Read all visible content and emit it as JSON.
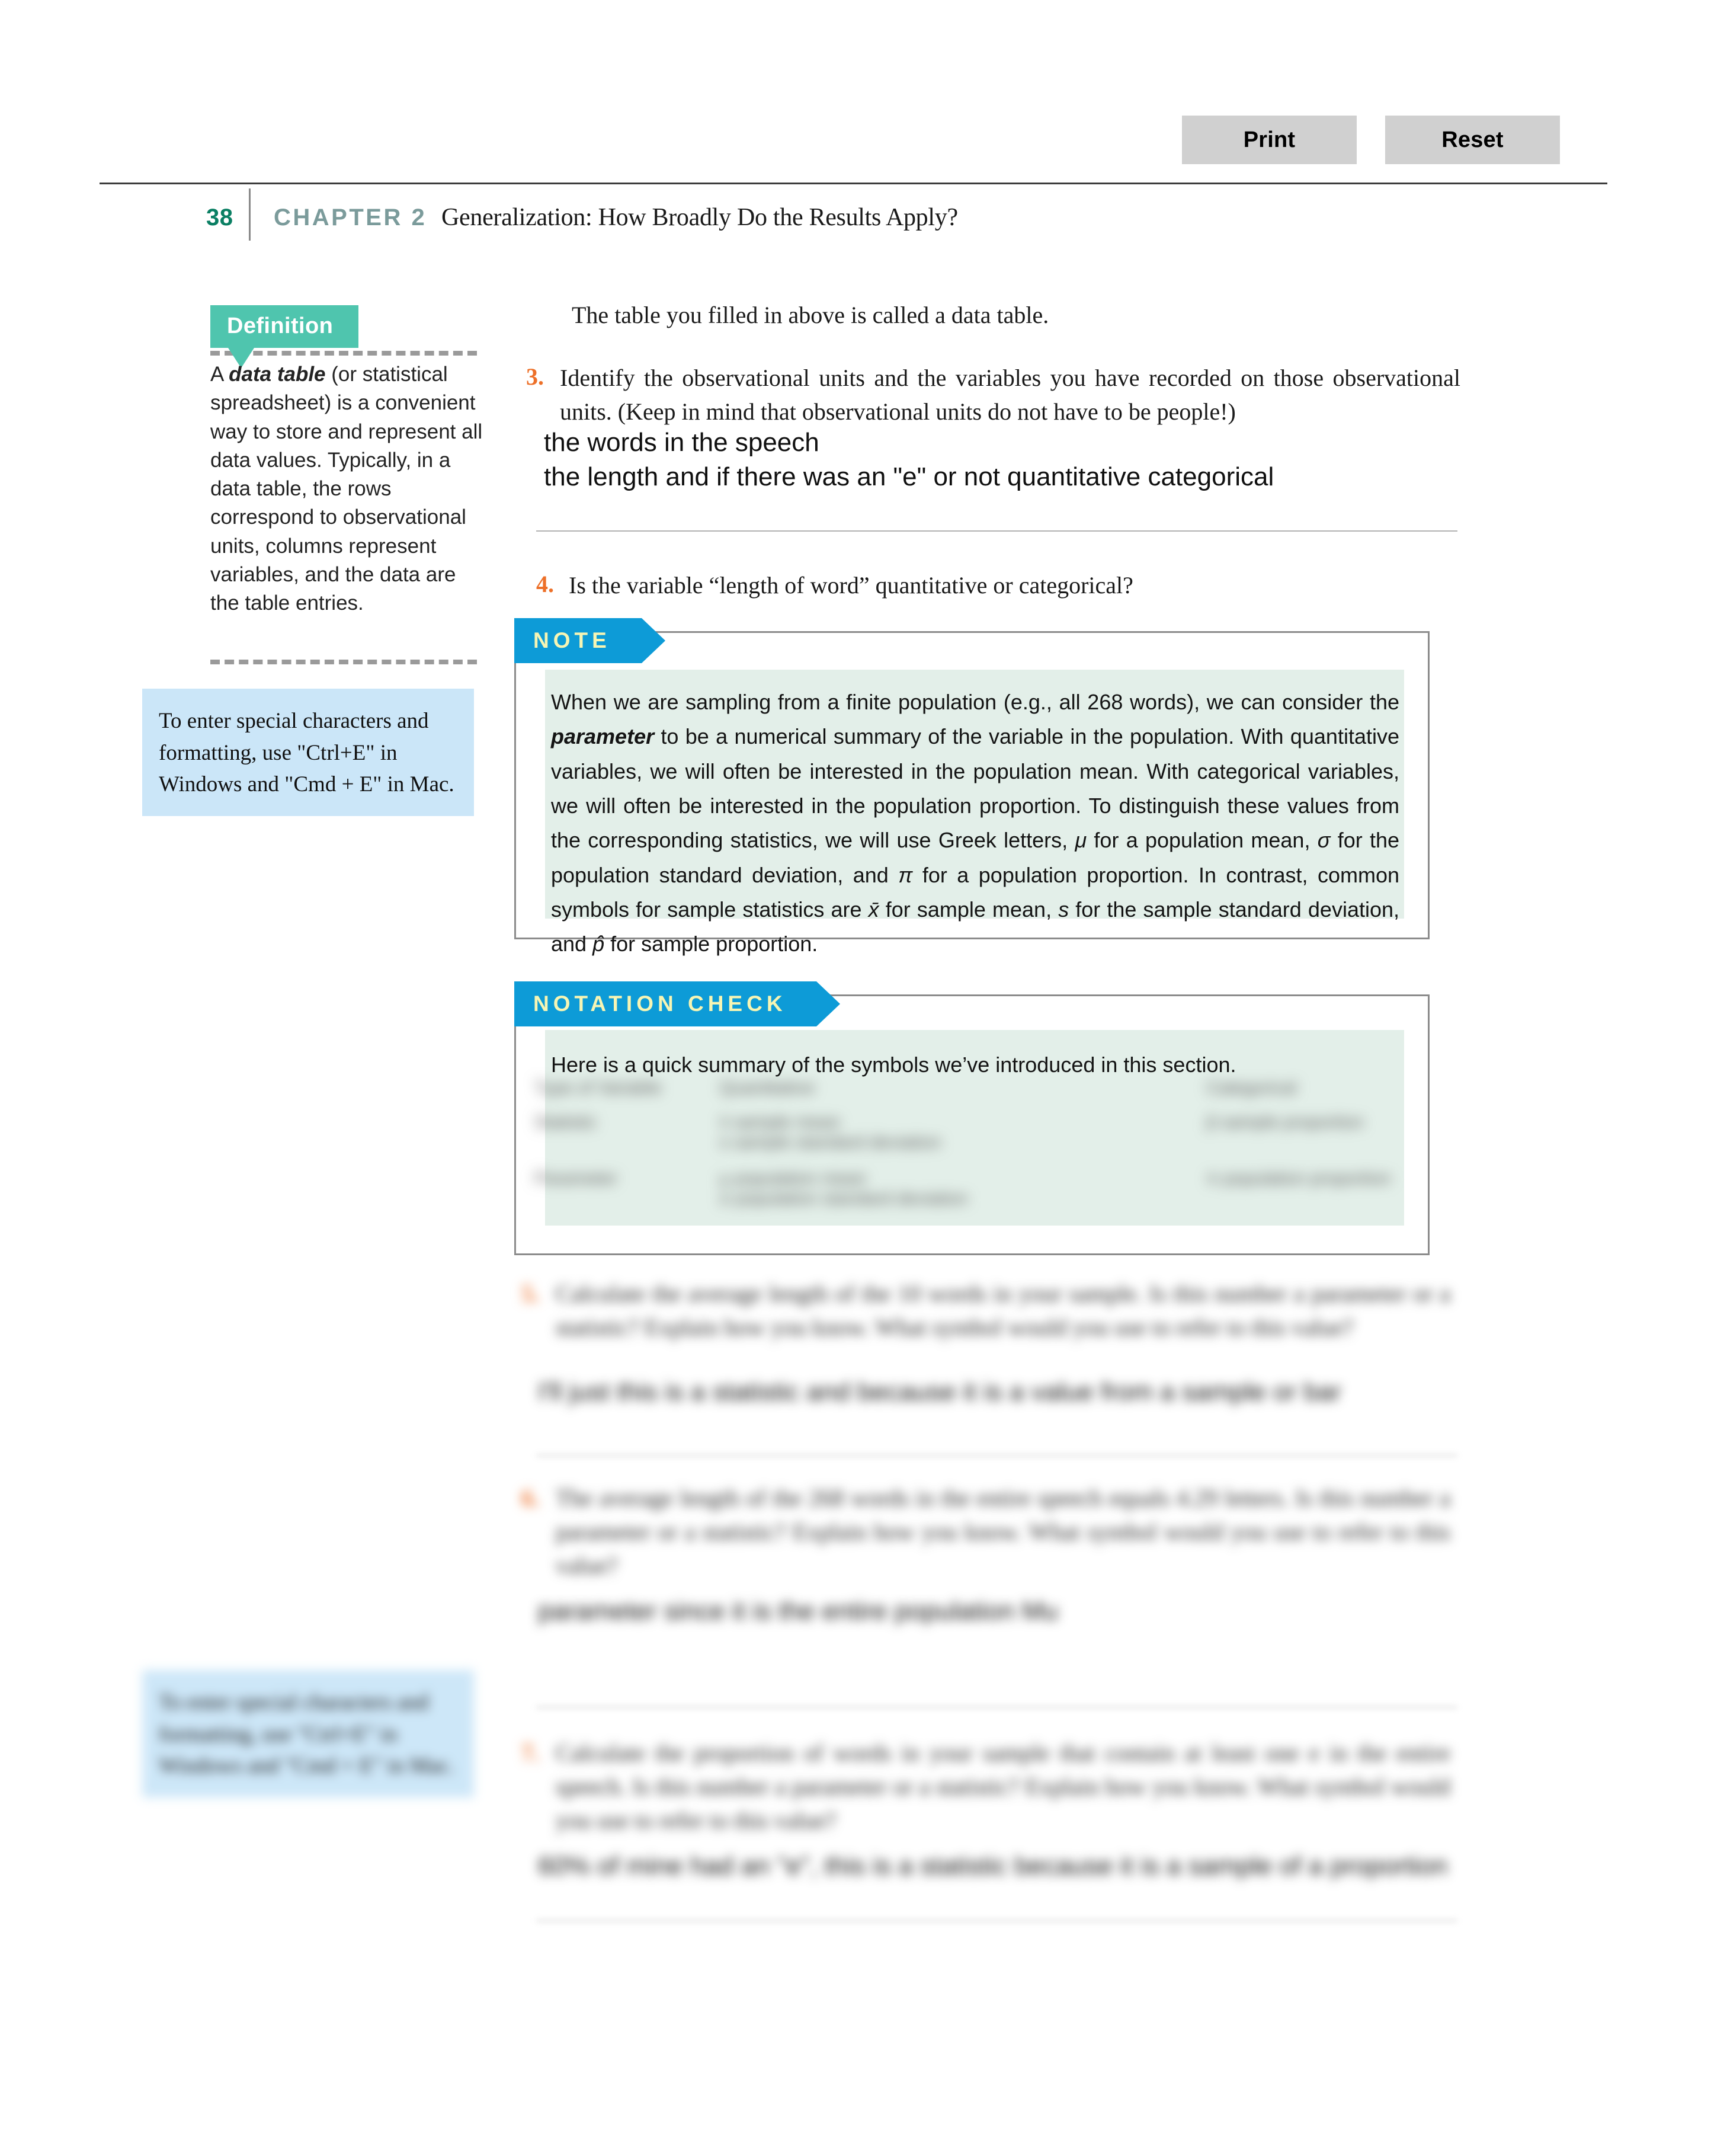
{
  "toolbar": {
    "print_label": "Print",
    "reset_label": "Reset"
  },
  "header": {
    "page_number": "38",
    "chapter_label": "CHAPTER 2",
    "chapter_title": "Generalization: How Broadly Do the Results Apply?",
    "page_number_color": "#0a7f63",
    "chapter_label_color": "#7b9b9b"
  },
  "definition": {
    "tab_label": "Definition",
    "tab_color": "#4fc5ae",
    "body_pre": "A ",
    "body_term": "data table",
    "body_post": " (or statistical spreadsheet) is a convenient way to store and represent all data values. Typically, in a data table, the rows correspond to observational units, columns represent variables, and the data are the table entries."
  },
  "tip": {
    "text": "To enter special characters and formatting, use \"Ctrl+E\" in Windows and \"Cmd + E\" in Mac.",
    "background": "#cbe6f8"
  },
  "main": {
    "lead_paragraph": "The table you filled in above is called a data table.",
    "q3": {
      "number": "3.",
      "text": "Identify the observational units and the variables you have recorded on those observational units. (Keep in mind that observational units do not have to be people!)",
      "answer_line1": "the words in the speech",
      "answer_line2": "the length and if there was an \"e\" or not quantitative categorical"
    },
    "q4": {
      "number": "4.",
      "text": "Is the variable “length of word” quantitative or categorical?"
    },
    "question_number_color": "#ed7029"
  },
  "note_box": {
    "tab_label": "NOTE",
    "tab_color": "#0d9bd7",
    "tab_text_color": "#f6f5b4",
    "body_color": "#e3efe9",
    "part1": "When we are sampling from a finite population (e.g., all 268 words), we can consider the ",
    "emphasis": "parameter",
    "part2": " to be a numerical summary of the variable in the population. With quantitative variables, we will often be interested in the population mean. With categorical variables, we will often be interested in the population proportion. To distinguish these values from the corresponding statistics, we will use Greek letters, ",
    "sym_mu": "μ",
    "part3": " for a population mean, ",
    "sym_sigma": "σ",
    "part4": " for the population standard deviation, and ",
    "sym_pi": "π",
    "part5": " for a population proportion. In contrast, common symbols for sample statistics are ",
    "sym_xbar": "x̄",
    "part6": " for sample mean, ",
    "sym_s": "s",
    "part7": " for the sample standard deviation, and ",
    "sym_phat": "p̂",
    "part8": " for sample proportion."
  },
  "notation_check": {
    "tab_label": "NOTATION CHECK",
    "intro": "Here is a quick summary of the symbols we’ve introduced in this section.",
    "table": {
      "headers": [
        "Type of Variable",
        "Quantitative",
        "Categorical"
      ],
      "rows": [
        {
          "label": "Statistic",
          "quantitative": [
            "x̄   sample mean",
            "s   sample standard deviation"
          ],
          "categorical": [
            "p̂   sample proportion"
          ]
        },
        {
          "label": "Parameter",
          "quantitative": [
            "μ   population mean",
            "σ   population standard deviation"
          ],
          "categorical": [
            "π   population proportion"
          ]
        }
      ]
    }
  },
  "blurred_exercises": [
    {
      "number": "5.",
      "text": "Calculate the average length of the 10 words in your sample. Is this number a parameter or a statistic? Explain how you know. What symbol would you use to refer to this value?",
      "answer": "I'll just this is a statistic and because it is a value from a sample or bar"
    },
    {
      "number": "6.",
      "text": "The average length of the 268 words in the entire speech equals 4.29 letters. Is this number a parameter or a statistic? Explain how you know. What symbol would you use to refer to this value?",
      "answer": "parameter since it is the entire population Mu"
    },
    {
      "number": "7.",
      "text": "Calculate the proportion of words in your sample that contain at least one e in the entire speech. Is this number a parameter or a statistic? Explain how you know. What symbol would you use to refer to this value?",
      "answer": "60% of mine had an \"e\", this is a statistic because it is a sample of a proportion"
    }
  ]
}
